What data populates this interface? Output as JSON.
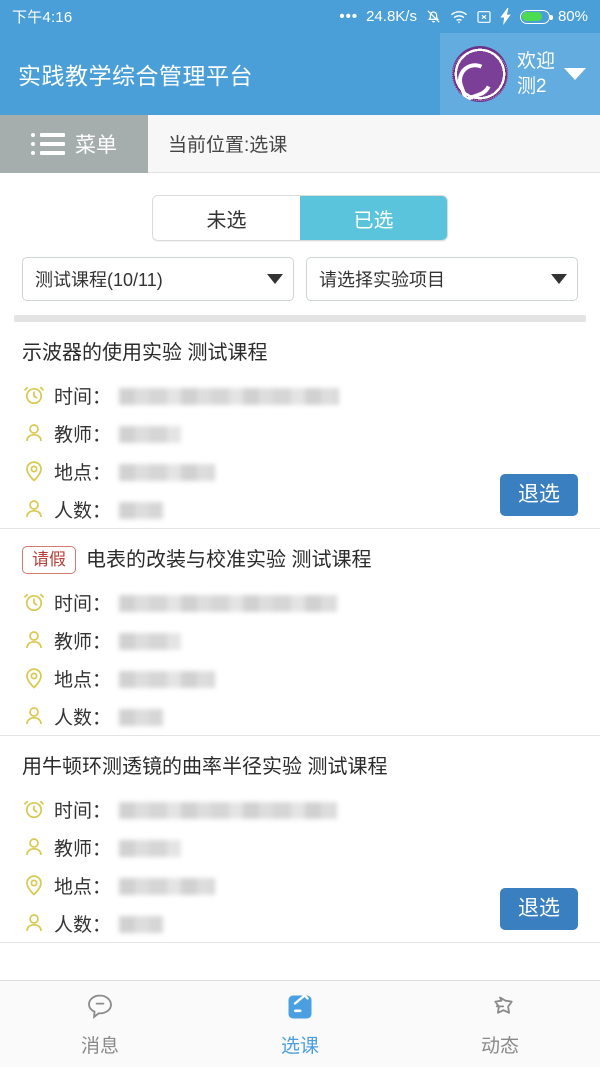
{
  "status_bar": {
    "clock": "下午4:16",
    "dots": "•••",
    "network_speed": "24.8K/s",
    "icons": [
      "bell-muted-icon",
      "wifi-icon",
      "no-signal-icon",
      "charging-bolt-icon",
      "battery-icon"
    ],
    "battery_percent": "80%",
    "battery_level": 80
  },
  "header": {
    "app_title": "实践教学综合管理平台",
    "logo_name": "university-seal-logo",
    "welcome_line1": "欢迎",
    "welcome_line2": "测2",
    "caret": "chevron-down-icon",
    "bg_color": "#4a9fd8",
    "user_bg_color": "#63ace0"
  },
  "menubar": {
    "menu_label": "菜单",
    "menu_icon": "list-menu-icon",
    "breadcrumb": "当前位置:选课",
    "menu_bg_color": "#a5adad"
  },
  "segment": {
    "items": [
      {
        "label": "未选",
        "active": false
      },
      {
        "label": "已选",
        "active": true
      }
    ],
    "active_color": "#5bc4dd"
  },
  "filters": [
    {
      "name": "course-select",
      "value": "测试课程(10/11)"
    },
    {
      "name": "experiment-select",
      "value": "请选择实验项目"
    }
  ],
  "row_labels": {
    "time": "时间：",
    "teacher": "教师：",
    "place": "地点：",
    "count": "人数："
  },
  "cards": [
    {
      "badge": null,
      "title": "示波器的使用实验 测试课程",
      "rows": [
        {
          "icon": "alarm-clock-icon",
          "label": "时间：",
          "value_redacted": true,
          "value_width": 220
        },
        {
          "icon": "person-icon",
          "label": "教师：",
          "value_redacted": true,
          "value_width": 62
        },
        {
          "icon": "location-pin-icon",
          "label": "地点：",
          "value_redacted": true,
          "value_width": 96
        },
        {
          "icon": "person-icon",
          "label": "人数：",
          "value_redacted": true,
          "value_width": 44
        }
      ],
      "button": "退选"
    },
    {
      "badge": "请假",
      "title": "电表的改装与校准实验 测试课程",
      "rows": [
        {
          "icon": "alarm-clock-icon",
          "label": "时间：",
          "value_redacted": true,
          "value_width": 218
        },
        {
          "icon": "person-icon",
          "label": "教师：",
          "value_redacted": true,
          "value_width": 62
        },
        {
          "icon": "location-pin-icon",
          "label": "地点：",
          "value_redacted": true,
          "value_width": 96
        },
        {
          "icon": "person-icon",
          "label": "人数：",
          "value_redacted": true,
          "value_width": 44
        }
      ],
      "button": null
    },
    {
      "badge": null,
      "title": "用牛顿环测透镜的曲率半径实验 测试课程",
      "rows": [
        {
          "icon": "alarm-clock-icon",
          "label": "时间：",
          "value_redacted": true,
          "value_width": 218
        },
        {
          "icon": "person-icon",
          "label": "教师：",
          "value_redacted": true,
          "value_width": 62
        },
        {
          "icon": "location-pin-icon",
          "label": "地点：",
          "value_redacted": true,
          "value_width": 96
        },
        {
          "icon": "person-icon",
          "label": "人数：",
          "value_redacted": true,
          "value_width": 44
        }
      ],
      "button": "退选"
    }
  ],
  "bottom_nav": [
    {
      "label": "消息",
      "icon": "speech-bubble-icon",
      "active": false
    },
    {
      "label": "选课",
      "icon": "note-pencil-icon",
      "active": true
    },
    {
      "label": "动态",
      "icon": "star-icon",
      "active": false
    }
  ],
  "colors": {
    "primary_blue": "#4a9fd8",
    "accent_cyan": "#5bc4dd",
    "button_blue": "#3a7fbf",
    "badge_red": "#b8413a",
    "row_icon_yellow": "#d9c84f",
    "nav_active": "#4a9fe0"
  }
}
